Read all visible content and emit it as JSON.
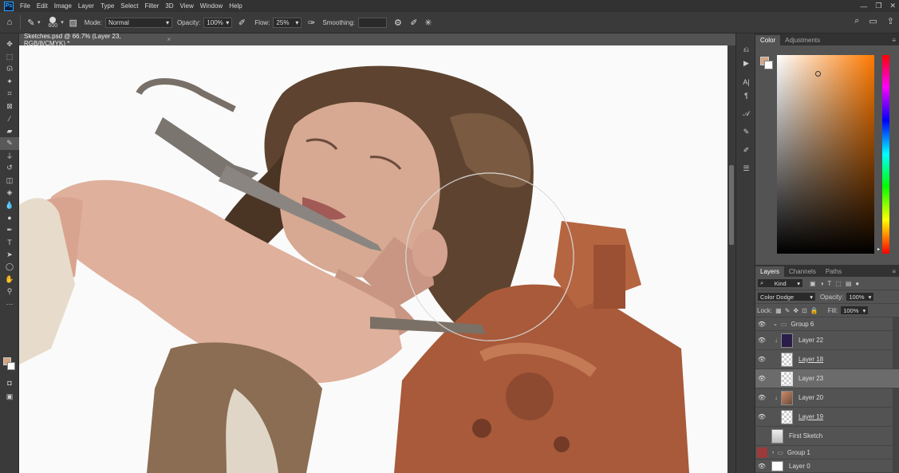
{
  "app": {
    "logo": "Ps",
    "menu": [
      "File",
      "Edit",
      "Image",
      "Layer",
      "Type",
      "Select",
      "Filter",
      "3D",
      "View",
      "Window",
      "Help"
    ],
    "window_controls": [
      "—",
      "❐",
      "✕"
    ]
  },
  "options": {
    "brush_size": "600",
    "mode_label": "Mode:",
    "mode_value": "Normal",
    "opacity_label": "Opacity:",
    "opacity_value": "100%",
    "flow_label": "Flow:",
    "flow_value": "25%",
    "smoothing_label": "Smoothing:",
    "smoothing_value": ""
  },
  "document": {
    "tab_title": "Sketches.psd @ 66.7% (Layer 23, RGB/8/CMYK) *",
    "close": "×"
  },
  "color_panel": {
    "tabs": [
      "Color",
      "Adjustments"
    ],
    "foreground": "#d4a583",
    "background": "#ffffff",
    "hue_color": "#ff7a00"
  },
  "layers_panel": {
    "tabs": [
      "Layers",
      "Channels",
      "Paths"
    ],
    "filter_kind": "Kind",
    "blend_mode": "Color Dodge",
    "opacity_label": "Opacity:",
    "opacity_value": "100%",
    "lock_label": "Lock:",
    "fill_label": "Fill:",
    "fill_value": "100%",
    "layers": [
      {
        "name": "Group 6",
        "type": "group",
        "visible": true
      },
      {
        "name": "Layer 22",
        "type": "layer",
        "visible": true,
        "clipped": true
      },
      {
        "name": "Layer 18",
        "type": "layer",
        "visible": true
      },
      {
        "name": "Layer 23",
        "type": "layer",
        "visible": true,
        "selected": true
      },
      {
        "name": "Layer 20",
        "type": "layer",
        "visible": true,
        "clipped": true
      },
      {
        "name": "Layer 19",
        "type": "layer",
        "visible": true
      },
      {
        "name": "First Sketch",
        "type": "layer",
        "visible": false
      },
      {
        "name": "Group 1",
        "type": "group",
        "visible": false
      },
      {
        "name": "Layer 0",
        "type": "layer",
        "visible": true
      }
    ]
  }
}
